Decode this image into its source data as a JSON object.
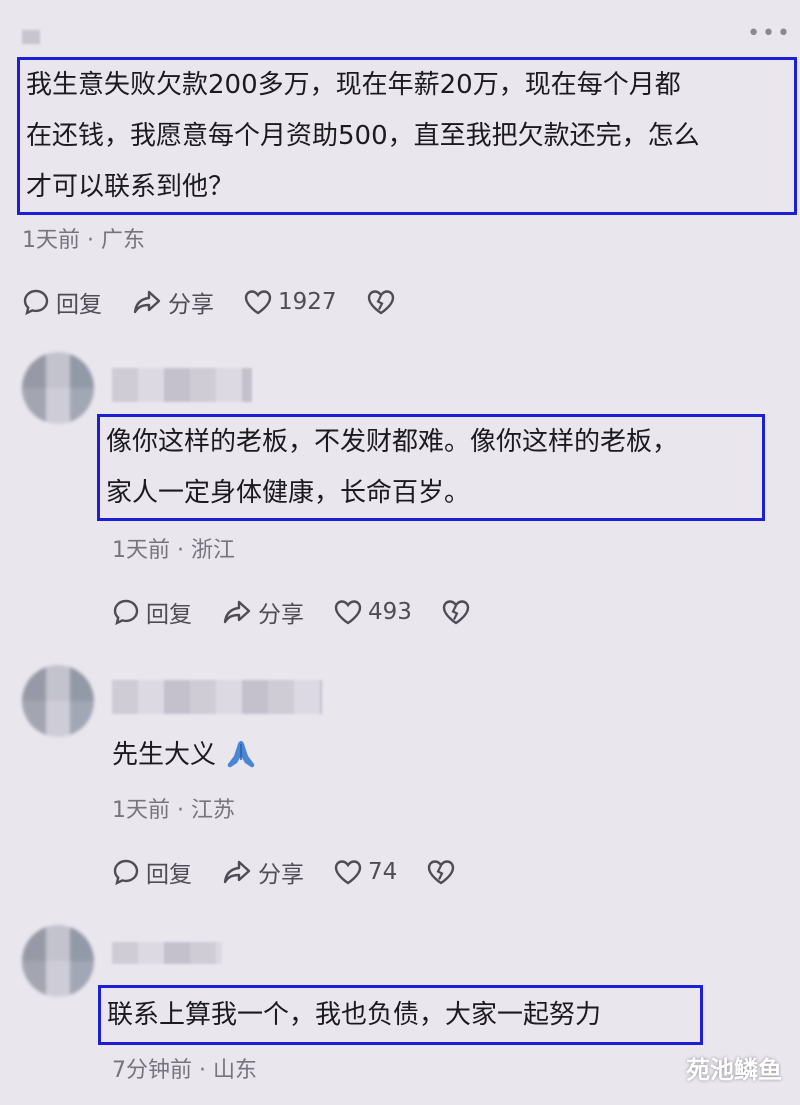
{
  "more_icon": "more-icon",
  "comments": [
    {
      "text": "我生意失败欠款200多万，现在年薪20万，现在每个月都在还钱，我愿意每个月资助500，直至我把欠款还完，怎么才可以联系到他？",
      "lines": [
        "我生意失败欠款200多万，现在年薪20万，现在每个月都",
        "在还钱，我愿意每个月资助500，直至我把欠款还完，怎么",
        "才可以联系到他？"
      ],
      "time": "1天前",
      "location": "广东",
      "reply_label": "回复",
      "share_label": "分享",
      "likes": "1927"
    },
    {
      "lines": [
        "像你这样的老板，不发财都难。像你这样的老板，",
        "家人一定身体健康，长命百岁。"
      ],
      "time": "1天前",
      "location": "浙江",
      "reply_label": "回复",
      "share_label": "分享",
      "likes": "493"
    },
    {
      "lines": [
        "先生大义"
      ],
      "emoji": "pray-hands-icon",
      "time": "1天前",
      "location": "江苏",
      "reply_label": "回复",
      "share_label": "分享",
      "likes": "74"
    },
    {
      "lines": [
        "联系上算我一个，我也负债，大家一起努力"
      ],
      "time": "7分钟前",
      "location": "山东"
    }
  ],
  "separator": "·",
  "watermark": "苑池鳞鱼",
  "colors": {
    "highlight_border": "#1d1fd4",
    "background": "#e9e6ee"
  }
}
